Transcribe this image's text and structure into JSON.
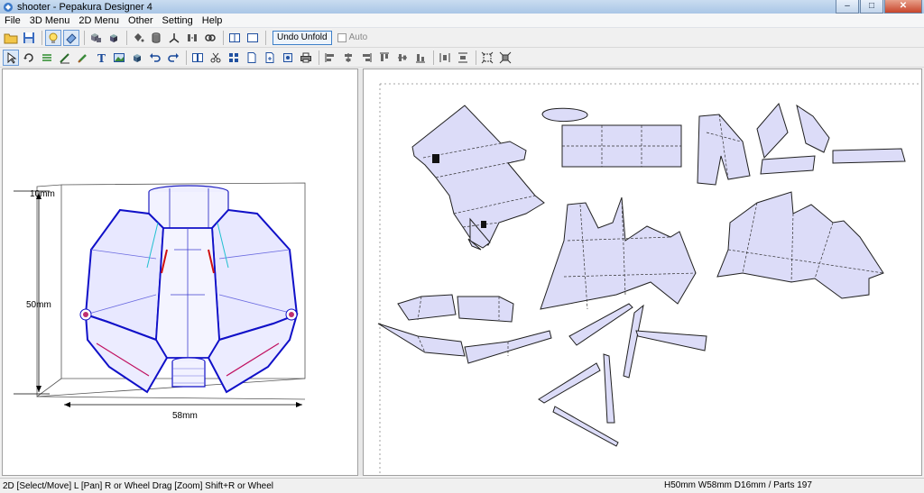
{
  "window": {
    "title": "shooter - Pepakura Designer 4",
    "minimize_glyph": "–",
    "maximize_glyph": "□",
    "close_glyph": "✕"
  },
  "menu": [
    "File",
    "3D Menu",
    "2D Menu",
    "Other",
    "Setting",
    "Help"
  ],
  "toolbar1": {
    "undo_unfold_label": "Undo Unfold",
    "auto_label": "Auto"
  },
  "view3d": {
    "dim_top": "10mm",
    "dim_height": "50mm",
    "dim_width": "58mm"
  },
  "status": {
    "left": "2D [Select/Move] L [Pan] R or Wheel Drag [Zoom] Shift+R or Wheel",
    "right": "H50mm W58mm D16mm / Parts 197"
  },
  "colors": {
    "part_fill": "#dcdcf8",
    "model_outline": "#1010c8",
    "fold_red": "#d01010",
    "titlebar": "#b5cde9"
  }
}
